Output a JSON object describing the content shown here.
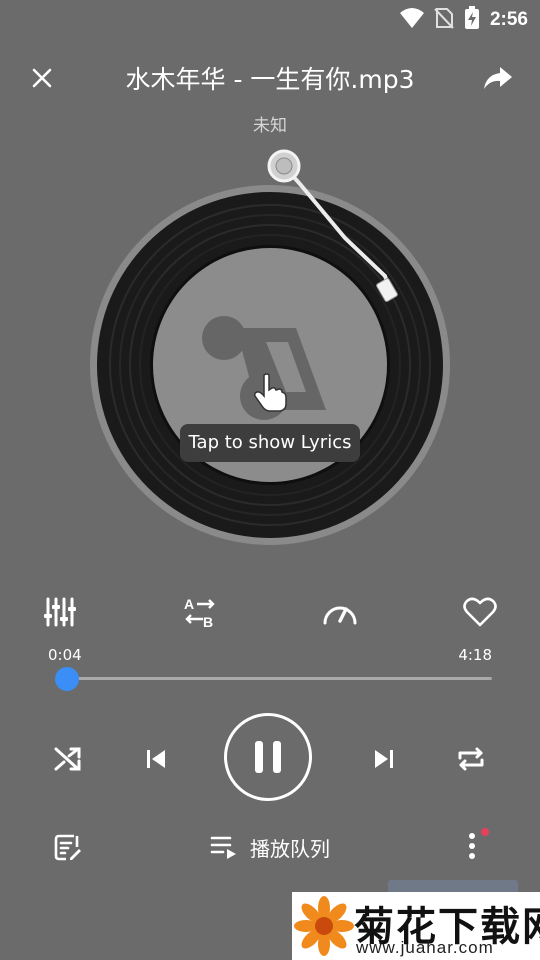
{
  "status_bar": {
    "time": "2:56",
    "icons": [
      "wifi-icon",
      "no-sim-icon",
      "battery-charging-icon"
    ]
  },
  "header": {
    "title": "水木年华 - 一生有你.mp3",
    "artist": "未知",
    "close_icon": "close-icon",
    "share_icon": "share-icon"
  },
  "disc": {
    "placeholder_icon": "music-note-icon",
    "tooltip": "Tap to show Lyrics"
  },
  "functions": [
    {
      "name": "equalizer-icon"
    },
    {
      "name": "ab-repeat-icon"
    },
    {
      "name": "speed-icon"
    },
    {
      "name": "favorite-heart-icon"
    }
  ],
  "progress": {
    "current": "0:04",
    "total": "4:18",
    "fraction": 0.0155,
    "color": "#3a8ef5"
  },
  "controls": {
    "shuffle": "shuffle-icon",
    "previous": "previous-icon",
    "play_pause": "pause-icon",
    "next": "next-icon",
    "repeat": "repeat-icon"
  },
  "bottom": {
    "lyrics_icon": "lyrics-icon",
    "queue_label": "播放队列",
    "more_icon": "more-vertical-icon",
    "notify_color": "#e8405a"
  },
  "watermark": {
    "text": "菊花下载网",
    "url": "www.juahar.com"
  },
  "colors": {
    "background": "#6b6b6b",
    "accent": "#3a8ef5"
  }
}
